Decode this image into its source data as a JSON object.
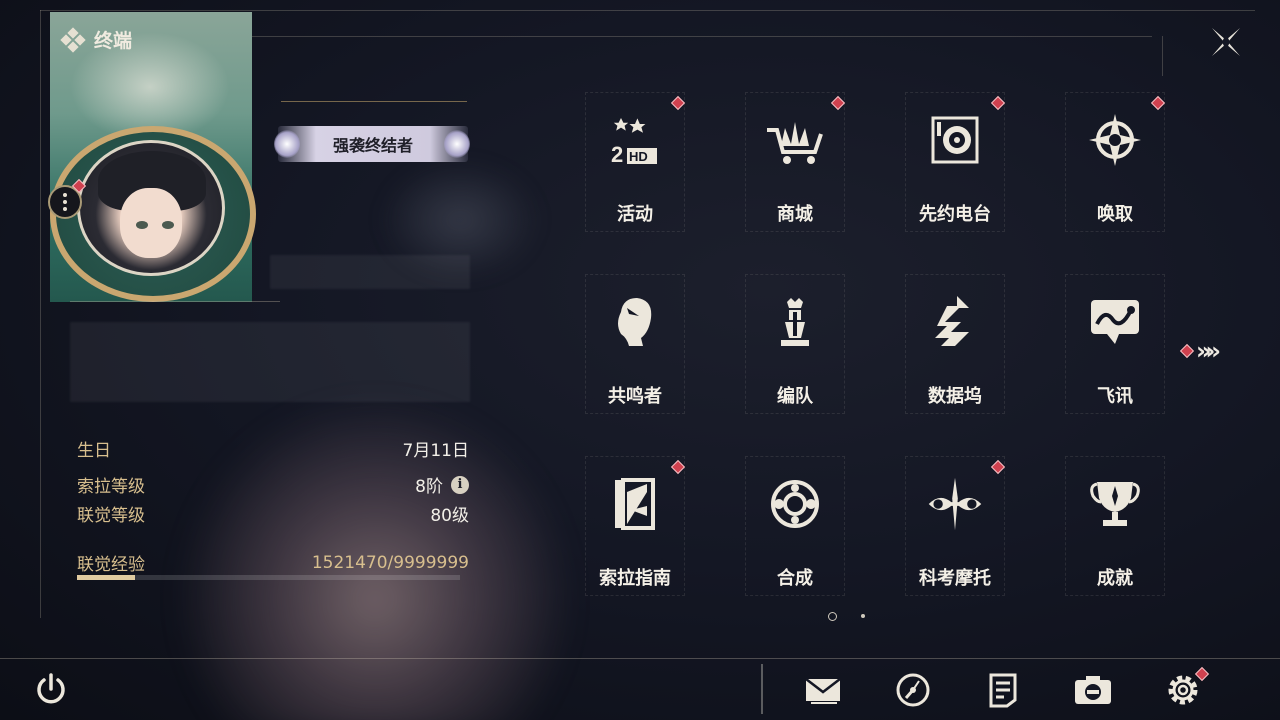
{
  "terminal": {
    "title": "终端"
  },
  "profile": {
    "title_badge": "强袭终结者",
    "stats": {
      "birthday_label": "生日",
      "birthday_value": "7月11日",
      "sonata_level_label": "索拉等级",
      "sonata_level_value": "8阶",
      "union_level_label": "联觉等级",
      "union_level_value": "80级",
      "union_exp_label": "联觉经验",
      "union_exp_value": "1521470/9999999",
      "union_exp_progress": 0.152147
    },
    "info_icon_glyph": "i"
  },
  "menu": {
    "items": [
      {
        "label": "活动",
        "icon": "event-2hd-icon",
        "badge": true
      },
      {
        "label": "商城",
        "icon": "shop-cart-icon",
        "badge": true
      },
      {
        "label": "先约电台",
        "icon": "radio-player-icon",
        "badge": true
      },
      {
        "label": "唤取",
        "icon": "convene-compass-icon",
        "badge": true
      },
      {
        "label": "共鸣者",
        "icon": "resonator-portrait-icon",
        "badge": false
      },
      {
        "label": "编队",
        "icon": "team-chess-icon",
        "badge": false
      },
      {
        "label": "数据坞",
        "icon": "data-bank-icon",
        "badge": false
      },
      {
        "label": "飞讯",
        "icon": "chat-message-icon",
        "badge": false
      },
      {
        "label": "索拉指南",
        "icon": "guidebook-icon",
        "badge": true
      },
      {
        "label": "合成",
        "icon": "synthesis-icon",
        "badge": false
      },
      {
        "label": "科考摩托",
        "icon": "motorbike-icon",
        "badge": true
      },
      {
        "label": "成就",
        "icon": "trophy-icon",
        "badge": false
      }
    ],
    "next_page_glyph": "»»",
    "page_count": 2,
    "current_page": 1
  },
  "bottom_bar": {
    "icons": [
      "mail-icon",
      "time-clock-icon",
      "notice-icon",
      "camera-icon",
      "settings-gear-icon"
    ]
  },
  "colors": {
    "accent_gold": "#d8bf8e",
    "badge_red": "#d0414f",
    "text_light": "#f4f0e7",
    "background": "#141724"
  }
}
